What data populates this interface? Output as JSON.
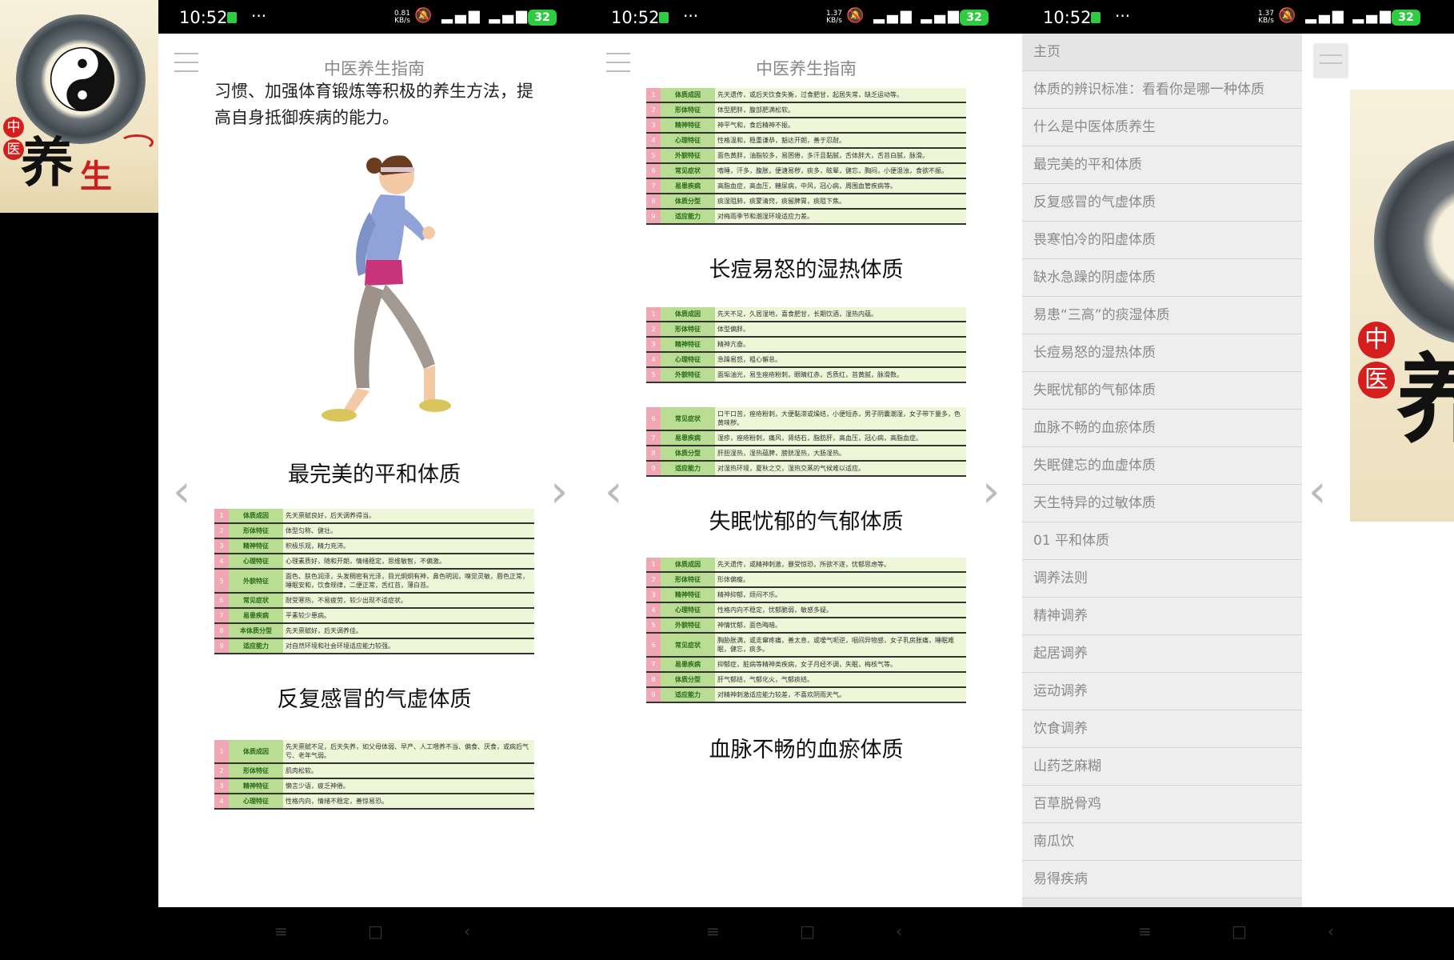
{
  "app_icon": {
    "seal_chars": [
      "中",
      "医"
    ],
    "title_char_1": "养",
    "title_char_2": "生"
  },
  "status_bar": {
    "time": "10:52",
    "more": "···",
    "battery": "32",
    "network_speed_1": "0.81 KB/s",
    "network_speed_2": "1.37 KB/s"
  },
  "app": {
    "title": "中医养生指南"
  },
  "nav_arrows": {
    "prev": "‹",
    "next": "›"
  },
  "phone1": {
    "intro": "习惯、加强体育锻炼等积极的养生方法，提高自身抵御疾病的能力。",
    "section1_title": "最完美的平和体质",
    "table1": [
      {
        "n": "1",
        "label": "体质成因",
        "text": "先天禀赋良好，后天调养得当。"
      },
      {
        "n": "2",
        "label": "形体特征",
        "text": "体型匀称、健壮。"
      },
      {
        "n": "3",
        "label": "精神特征",
        "text": "积极乐观，精力充沛。"
      },
      {
        "n": "4",
        "label": "心理特征",
        "text": "心理素质好，随和开朗，情绪稳定，思维敏智，不偏激。"
      },
      {
        "n": "5",
        "label": "外貌特征",
        "text": "面色、肤色润泽，头发稠密有光泽，目光炯炯有神，鼻色明润，嗅觉灵敏，唇色正常，睡眠安和，饮食规律，二便正常，舌红苔，薄白苔。"
      },
      {
        "n": "6",
        "label": "常见症状",
        "text": "耐受寒热，不易疲劳，较少出现不适症状。"
      },
      {
        "n": "7",
        "label": "易患疾病",
        "text": "平素较少患病。"
      },
      {
        "n": "8",
        "label": "本体质分型",
        "text": "先天禀赋好，后天调养佳。"
      },
      {
        "n": "9",
        "label": "适应能力",
        "text": "对自然环境和社会环境适应能力较强。"
      }
    ],
    "section2_title": "反复感冒的气虚体质",
    "table2": [
      {
        "n": "1",
        "label": "体质成因",
        "text": "先天禀赋不足，后天失养，如父母体弱、早产、人工喂养不当、偏食、厌食，或病后气亏、老年气弱。"
      },
      {
        "n": "2",
        "label": "形体特征",
        "text": "肌肉松软。"
      },
      {
        "n": "3",
        "label": "精神特征",
        "text": "懒言少语，疲乏神倦。"
      },
      {
        "n": "4",
        "label": "心理特征",
        "text": "性格内向，情绪不稳定，善惊易恐。"
      }
    ]
  },
  "phone2": {
    "table_top": [
      {
        "n": "1",
        "label": "体质成因",
        "text": "先天遗传，或后天饮食失衡，过食肥甘，起居失常，缺乏运动等。"
      },
      {
        "n": "2",
        "label": "形体特征",
        "text": "体型肥胖，腹部肥满松软。"
      },
      {
        "n": "3",
        "label": "精神特征",
        "text": "神平气和，食后精神不振。"
      },
      {
        "n": "4",
        "label": "心理特征",
        "text": "性格温和，稳重谦恭，豁达开朗，善于忍耐。"
      },
      {
        "n": "5",
        "label": "外貌特征",
        "text": "面色黄胖，油脂较多，易困倦，多汗且黏腻，舌体胖大，舌苔白腻，脉滑。"
      },
      {
        "n": "6",
        "label": "常见症状",
        "text": "嗜睡，汗多，腹胀，便溏易秽，痰多，眩晕，健忘，胸闷，小便混浊，食欲不振。"
      },
      {
        "n": "7",
        "label": "易患疾病",
        "text": "高脂血症，高血压，糖尿病，中风，冠心病，周围血管疾病等。"
      },
      {
        "n": "8",
        "label": "体质分型",
        "text": "痰湿阻肺，痰蒙清窍，痰留脾胃，痰阻下焦。"
      },
      {
        "n": "9",
        "label": "适应能力",
        "text": "对梅雨季节和潮湿环境适应力差。"
      }
    ],
    "section1_title": "长痘易怒的湿热体质",
    "table_a": [
      {
        "n": "1",
        "label": "体质成因",
        "text": "先天不足，久居湿地，喜食肥甘，长期饮酒，湿热内蕴。"
      },
      {
        "n": "2",
        "label": "形体特征",
        "text": "体型偏胖。"
      },
      {
        "n": "3",
        "label": "精神特征",
        "text": "精神亢奋。"
      },
      {
        "n": "4",
        "label": "心理特征",
        "text": "急躁易怒，粗心懈怠。"
      },
      {
        "n": "5",
        "label": "外貌特征",
        "text": "面垢油光，易生痤疮粉刺，眼睛红赤，舌质红，苔黄腻，脉滑数。"
      }
    ],
    "table_b": [
      {
        "n": "6",
        "label": "常见症状",
        "text": "口干口苦，痤疮粉刺，大便黏滞或燥结，小便短赤，男子阴囊潮湿，女子带下量多，色黄味秽。"
      },
      {
        "n": "7",
        "label": "易患疾病",
        "text": "湿疹，痤疮粉刺，痛风，肾结石，脂肪肝，高血压，冠心病，高脂血症。"
      },
      {
        "n": "8",
        "label": "体质分型",
        "text": "肝胆湿热，湿热蕴脾，膀胱湿热，大肠湿热。"
      },
      {
        "n": "9",
        "label": "适应能力",
        "text": "对湿热环境，夏秋之交，湿热交蒸的气候难以适应。"
      }
    ],
    "section2_title": "失眠忧郁的气郁体质",
    "table_c": [
      {
        "n": "1",
        "label": "体质成因",
        "text": "先天遗传，或精神刺激，暴受惊恐，所欲不遂，忧郁思虑等。"
      },
      {
        "n": "2",
        "label": "形体特征",
        "text": "形体偏瘦。"
      },
      {
        "n": "3",
        "label": "精神特征",
        "text": "精神抑郁，烦闷不乐。"
      },
      {
        "n": "4",
        "label": "心理特征",
        "text": "性格内向不稳定，忧郁脆弱，敏感多疑。"
      },
      {
        "n": "5",
        "label": "外貌特征",
        "text": "神情忧郁，面色晦暗。"
      },
      {
        "n": "6",
        "label": "常见症状",
        "text": "胸胁胀满，或走窜疼痛，善太息，或嗳气呃逆，咽间异物感，女子乳房胀痛，睡眠难眠，健忘，痰多。"
      },
      {
        "n": "7",
        "label": "易患疾病",
        "text": "抑郁症，脏病等精神类疾病，女子月经不调，失眠，梅核气等。"
      },
      {
        "n": "8",
        "label": "体质分型",
        "text": "肝气郁结，气郁化火，气郁痰结。"
      },
      {
        "n": "9",
        "label": "适应能力",
        "text": "对精神刺激适应能力较差，不喜欢阴雨天气。"
      }
    ],
    "section3_title": "血脉不畅的血瘀体质"
  },
  "phone3": {
    "drawer_items": [
      "主页",
      "体质的辨识标准：看看你是哪一种体质",
      "什么是中医体质养生",
      "最完美的平和体质",
      "反复感冒的气虚体质",
      "畏寒怕冷的阳虚体质",
      "缺水急躁的阴虚体质",
      "易患“三高”的痰湿体质",
      "长痘易怒的湿热体质",
      "失眠忧郁的气郁体质",
      "血脉不畅的血瘀体质",
      "失眠健忘的血虚体质",
      "天生特异的过敏体质",
      "01 平和体质",
      "调养法则",
      "精神调养",
      "起居调养",
      "运动调养",
      "饮食调养",
      "山药芝麻糊",
      "百草脱骨鸡",
      "南瓜饮",
      "易得疾病"
    ],
    "banner_seal": [
      "中",
      "医"
    ],
    "banner_char": "养"
  },
  "system_nav": {
    "menu": "≡",
    "home": "□",
    "back": "‹"
  }
}
